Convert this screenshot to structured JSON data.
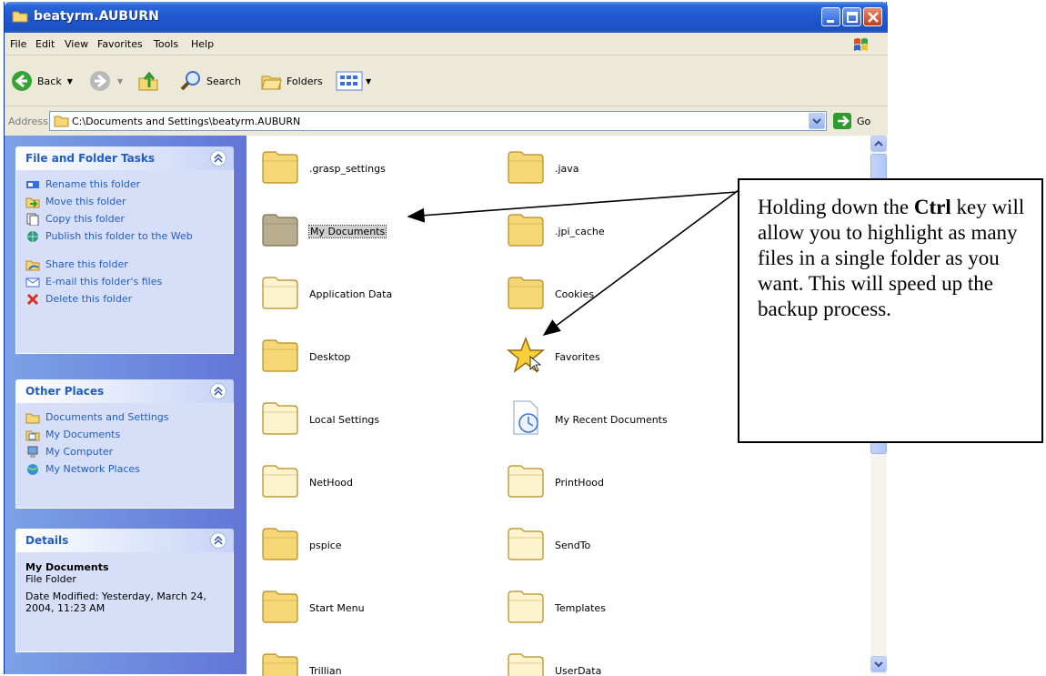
{
  "window": {
    "title": "beatyrm.AUBURN"
  },
  "menu": [
    "File",
    "Edit",
    "View",
    "Favorites",
    "Tools",
    "Help"
  ],
  "toolbar": {
    "back": "Back",
    "search": "Search",
    "folders": "Folders"
  },
  "address": {
    "label": "Address",
    "path": "C:\\Documents and Settings\\beatyrm.AUBURN",
    "go": "Go"
  },
  "tasks": {
    "title": "File and Folder Tasks",
    "items": [
      "Rename this folder",
      "Move this folder",
      "Copy this folder",
      "Publish this folder to the Web",
      "Share this folder",
      "E-mail this folder's files",
      "Delete this folder"
    ]
  },
  "places": {
    "title": "Other Places",
    "items": [
      "Documents and Settings",
      "My Documents",
      "My Computer",
      "My Network Places"
    ]
  },
  "details": {
    "title": "Details",
    "name": "My Documents",
    "type": "File Folder",
    "modified": "Date Modified: Yesterday, March 24, 2004, 11:23 AM"
  },
  "files": [
    ".grasp_settings",
    ".java",
    "My Documents",
    ".jpi_cache",
    "Application Data",
    "Cookies",
    "Desktop",
    "Favorites",
    "Local Settings",
    "My Recent Documents",
    "NetHood",
    "PrintHood",
    "pspice",
    "SendTo",
    "Start Menu",
    "Templates",
    "Trillian",
    "UserData"
  ],
  "callout": {
    "pre": "Holding down the ",
    "bold": "Ctrl",
    "post": " key will allow you to highlight as many files in a single folder as you want. This will speed up the backup process."
  }
}
